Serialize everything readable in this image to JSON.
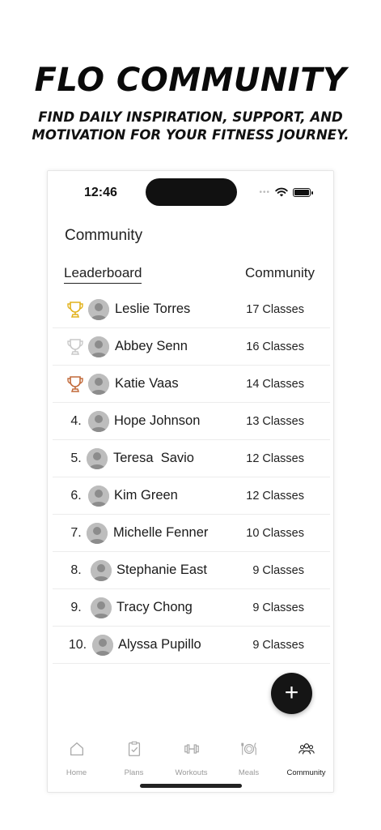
{
  "promo": {
    "title": "FLO COMMUNITY",
    "subtitle_line1": "FIND DAILY INSPIRATION, SUPPORT, AND",
    "subtitle_line2": "MOTIVATION FOR YOUR FITNESS JOURNEY."
  },
  "status_bar": {
    "time": "12:46",
    "dots": "•••"
  },
  "page": {
    "title": "Community"
  },
  "tabs": {
    "leaderboard": "Leaderboard",
    "community": "Community",
    "active": "Leaderboard"
  },
  "leaderboard": [
    {
      "rank": "",
      "trophy": "gold",
      "name": "Leslie Torres",
      "classes": "17 Classes"
    },
    {
      "rank": "",
      "trophy": "silver",
      "name": "Abbey Senn",
      "classes": "16 Classes"
    },
    {
      "rank": "",
      "trophy": "bronze",
      "name": "Katie Vaas",
      "classes": "14 Classes"
    },
    {
      "rank": "4.",
      "trophy": "",
      "name": "Hope Johnson",
      "classes": "13 Classes"
    },
    {
      "rank": "5.",
      "trophy": "",
      "name": "Teresa  Savio",
      "classes": "12 Classes"
    },
    {
      "rank": "6.",
      "trophy": "",
      "name": "Kim Green",
      "classes": "12 Classes"
    },
    {
      "rank": "7.",
      "trophy": "",
      "name": "Michelle Fenner",
      "classes": "10 Classes"
    },
    {
      "rank": "8.",
      "trophy": "",
      "name": "Stephanie East",
      "classes": "9 Classes"
    },
    {
      "rank": "9.",
      "trophy": "",
      "name": "Tracy Chong",
      "classes": "9 Classes"
    },
    {
      "rank": "10.",
      "trophy": "",
      "name": "Alyssa Pupillo",
      "classes": "9 Classes"
    }
  ],
  "fab": {
    "label": "+"
  },
  "nav": [
    {
      "label": "Home",
      "icon": "home-icon",
      "active": false
    },
    {
      "label": "Plans",
      "icon": "clipboard-check-icon",
      "active": false
    },
    {
      "label": "Workouts",
      "icon": "dumbbell-icon",
      "active": false
    },
    {
      "label": "Meals",
      "icon": "fork-plate-knife-icon",
      "active": false
    },
    {
      "label": "Community",
      "icon": "people-group-icon",
      "active": true
    }
  ],
  "colors": {
    "trophy_gold": "#E2B21C",
    "trophy_silver": "#C9C9C9",
    "trophy_bronze": "#C26A3A",
    "fab_bg": "#151515",
    "nav_inactive": "#9A9A9A",
    "avatar_bg": "#BDBDBD"
  }
}
